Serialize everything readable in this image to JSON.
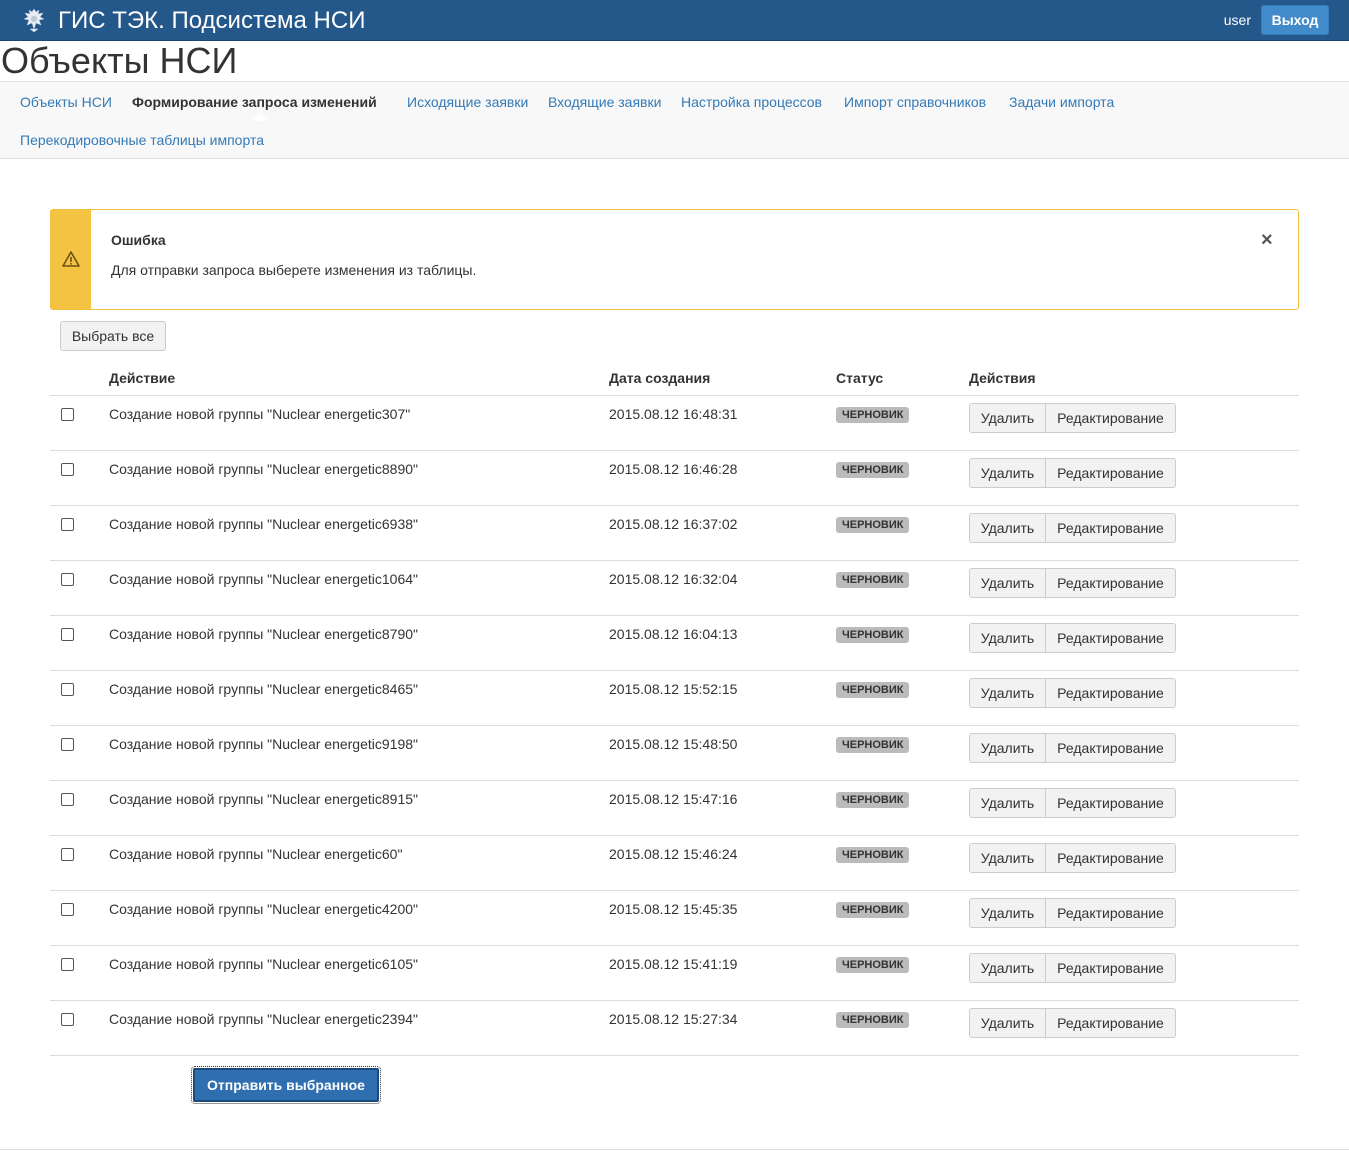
{
  "header": {
    "app_title": "ГИС ТЭК. Подсистема НСИ",
    "user": "user",
    "logout_label": "Выход",
    "emblem_icon": "coat-of-arms-icon"
  },
  "page_title": "Объекты НСИ",
  "nav": {
    "items": [
      {
        "label": "Объекты НСИ",
        "active": false
      },
      {
        "label": "Формирование запроса изменений",
        "active": true
      },
      {
        "label": "Исходящие заявки",
        "active": false
      },
      {
        "label": "Входящие заявки",
        "active": false
      },
      {
        "label": "Настройка процессов",
        "active": false
      },
      {
        "label": "Импорт справочников",
        "active": false
      },
      {
        "label": "Задачи импорта",
        "active": false
      },
      {
        "label": "Перекодировочные таблицы импорта",
        "active": false
      }
    ]
  },
  "alert": {
    "title": "Ошибка",
    "text": "Для отправки запроса выберете изменения из таблицы.",
    "close_glyph": "×",
    "icon": "warning-icon",
    "accent_color": "#f5c342"
  },
  "select_all_label": "Выбрать все",
  "table": {
    "headers": {
      "action": "Действие",
      "date": "Дата создания",
      "status": "Статус",
      "actions": "Действия"
    },
    "delete_label": "Удалить",
    "edit_label": "Редактирование",
    "rows": [
      {
        "action": "Создание новой группы \"Nuclear energetic307\"",
        "date": "2015.08.12 16:48:31",
        "status": "ЧЕРНОВИК"
      },
      {
        "action": "Создание новой группы \"Nuclear energetic8890\"",
        "date": "2015.08.12 16:46:28",
        "status": "ЧЕРНОВИК"
      },
      {
        "action": "Создание новой группы \"Nuclear energetic6938\"",
        "date": "2015.08.12 16:37:02",
        "status": "ЧЕРНОВИК"
      },
      {
        "action": "Создание новой группы \"Nuclear energetic1064\"",
        "date": "2015.08.12 16:32:04",
        "status": "ЧЕРНОВИК"
      },
      {
        "action": "Создание новой группы \"Nuclear energetic8790\"",
        "date": "2015.08.12 16:04:13",
        "status": "ЧЕРНОВИК"
      },
      {
        "action": "Создание новой группы \"Nuclear energetic8465\"",
        "date": "2015.08.12 15:52:15",
        "status": "ЧЕРНОВИК"
      },
      {
        "action": "Создание новой группы \"Nuclear energetic9198\"",
        "date": "2015.08.12 15:48:50",
        "status": "ЧЕРНОВИК"
      },
      {
        "action": "Создание новой группы \"Nuclear energetic8915\"",
        "date": "2015.08.12 15:47:16",
        "status": "ЧЕРНОВИК"
      },
      {
        "action": "Создание новой группы \"Nuclear energetic60\"",
        "date": "2015.08.12 15:46:24",
        "status": "ЧЕРНОВИК"
      },
      {
        "action": "Создание новой группы \"Nuclear energetic4200\"",
        "date": "2015.08.12 15:45:35",
        "status": "ЧЕРНОВИК"
      },
      {
        "action": "Создание новой группы \"Nuclear energetic6105\"",
        "date": "2015.08.12 15:41:19",
        "status": "ЧЕРНОВИК"
      },
      {
        "action": "Создание новой группы \"Nuclear energetic2394\"",
        "date": "2015.08.12 15:27:34",
        "status": "ЧЕРНОВИК"
      }
    ]
  },
  "submit_label": "Отправить выбранное",
  "colors": {
    "header_bg": "#24578a",
    "link": "#337ab7",
    "primary": "#2f6fb0"
  }
}
